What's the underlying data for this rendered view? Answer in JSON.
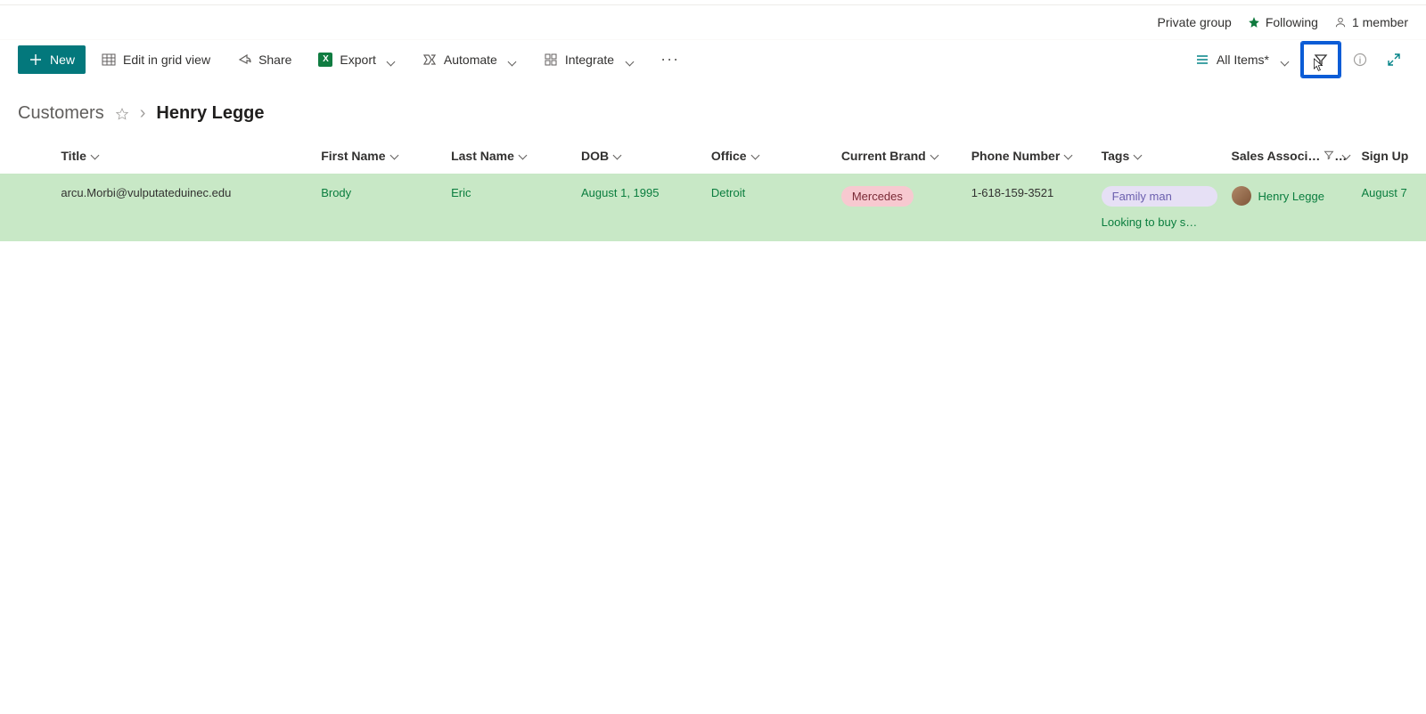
{
  "header": {
    "privacy": "Private group",
    "following": "Following",
    "members": "1 member"
  },
  "toolbar": {
    "new": "New",
    "edit_grid": "Edit in grid view",
    "share": "Share",
    "export": "Export",
    "automate": "Automate",
    "integrate": "Integrate",
    "view_label": "All Items*"
  },
  "breadcrumb": {
    "root": "Customers",
    "current": "Henry Legge"
  },
  "columns": {
    "title": "Title",
    "first_name": "First Name",
    "last_name": "Last Name",
    "dob": "DOB",
    "office": "Office",
    "brand": "Current Brand",
    "phone": "Phone Number",
    "tags": "Tags",
    "assoc": "Sales Associ…",
    "signup": "Sign Up"
  },
  "row": {
    "title": "arcu.Morbi@vulputateduinec.edu",
    "first_name": "Brody",
    "last_name": "Eric",
    "dob": "August 1, 1995",
    "office": "Detroit",
    "brand": "Mercedes",
    "phone": "1-618-159-3521",
    "tag1": "Family man",
    "tag2": "Looking to buy s…",
    "assoc": "Henry Legge",
    "signup": "August 7"
  }
}
